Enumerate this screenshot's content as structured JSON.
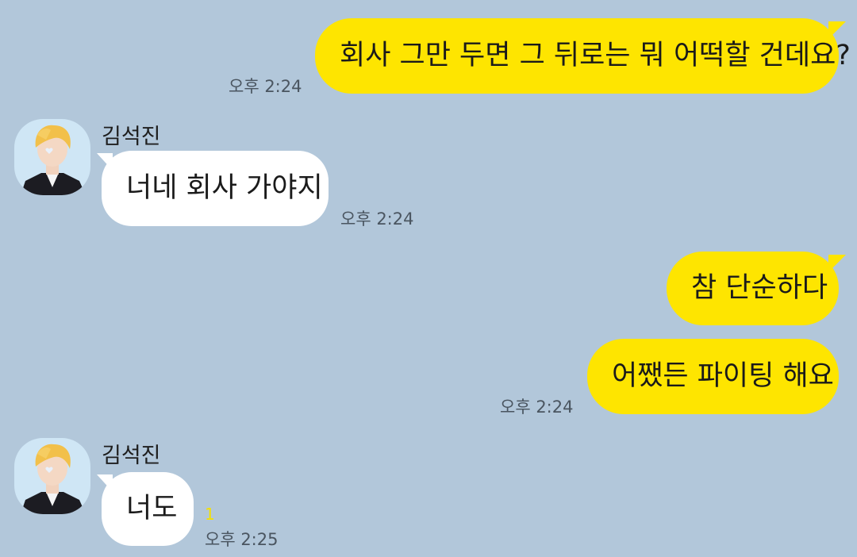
{
  "messages": [
    {
      "text": "회사 그만 두면 그 뒤로는 뭐 어떡할 건데요?",
      "time": "오후 2:24"
    },
    {
      "sender": "김석진",
      "text": "너네 회사 가야지",
      "time": "오후 2:24"
    },
    {
      "text": "참 단순하다"
    },
    {
      "text": "어쨌든 파이팅 해요",
      "time": "오후 2:24"
    },
    {
      "sender": "김석진",
      "text": "너도",
      "unread": "1",
      "time": "오후 2:25"
    }
  ],
  "colors": {
    "background": "#b2c7da",
    "my_bubble": "#fee500",
    "their_bubble": "#ffffff",
    "unread_count": "#f5e000"
  },
  "icons": {
    "avatar": "profile-photo-avatar"
  }
}
